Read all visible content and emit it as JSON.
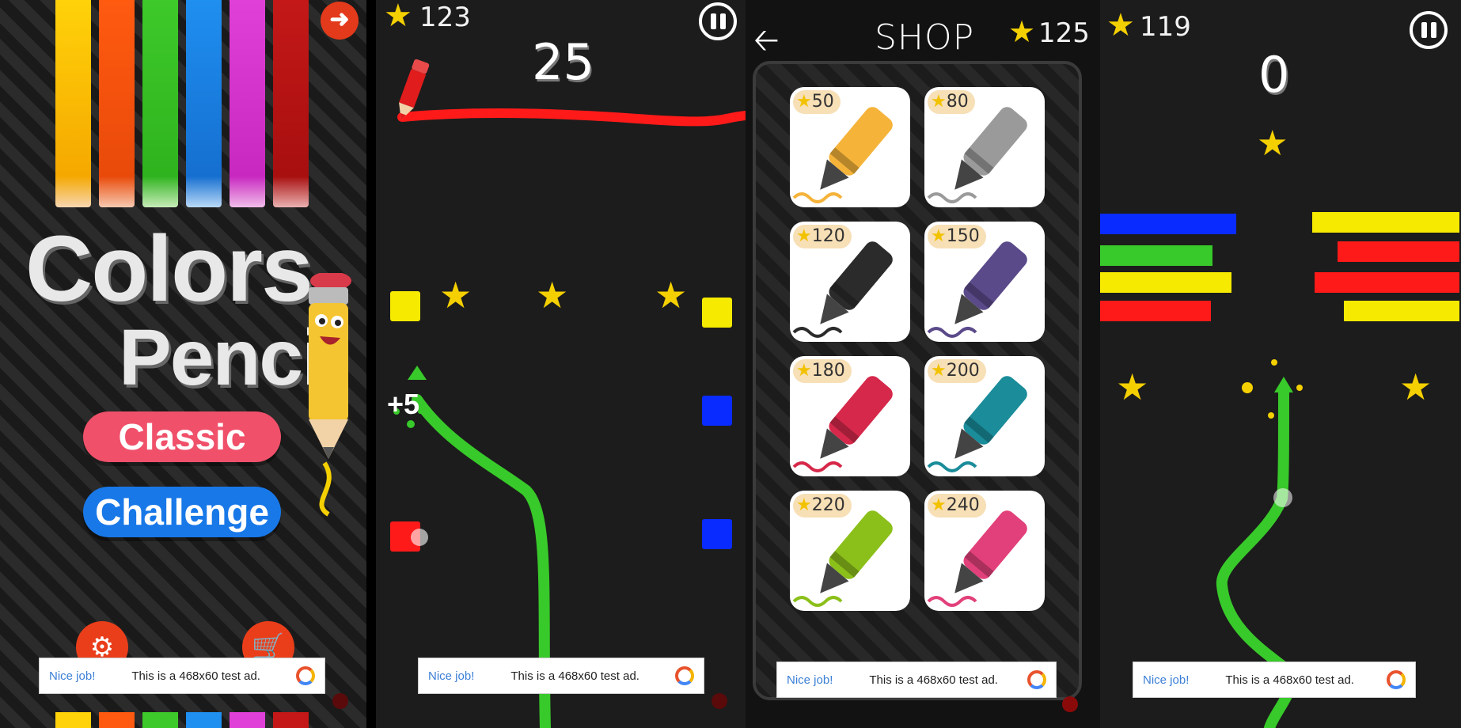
{
  "menu": {
    "title_line1": "Colors",
    "title_line2": "Pencil",
    "classic_label": "Classic",
    "challenge_label": "Challenge",
    "back_icon": "back-arrow-icon",
    "settings_icon": "gear-icon",
    "shop_icon": "cart-icon",
    "bar_colors": [
      "#ffd20a",
      "#ff5a10",
      "#3ec92a",
      "#1f8ff0",
      "#e040d8",
      "#c41818"
    ]
  },
  "game1": {
    "star_count": "123",
    "score": "25",
    "bonus": "+5"
  },
  "shop": {
    "title": "SHOP",
    "star_count": "125",
    "items": [
      {
        "price": "50",
        "item": "highlighter-orange",
        "color": "#f5b33a"
      },
      {
        "price": "80",
        "item": "crayon-gray",
        "color": "#9a9a9a"
      },
      {
        "price": "120",
        "item": "fountain-pen-black",
        "color": "#2b2b2b"
      },
      {
        "price": "150",
        "item": "fountain-pen-purple",
        "color": "#5b4a8a"
      },
      {
        "price": "180",
        "item": "marker-red",
        "color": "#d6284a"
      },
      {
        "price": "200",
        "item": "marker-teal",
        "color": "#1a8c9a"
      },
      {
        "price": "220",
        "item": "brush-green",
        "color": "#8bbf1a"
      },
      {
        "price": "240",
        "item": "brush-pink",
        "color": "#e2407a"
      }
    ]
  },
  "game2": {
    "star_count": "119",
    "score": "0"
  },
  "ad": {
    "nice_label": "Nice job!",
    "message": "This is a 468x60 test ad."
  },
  "colors": {
    "red": "#ff1a1a",
    "green": "#38c92a",
    "yellow": "#f5ea00",
    "blue": "#0a2bff",
    "classic_btn": "#f0506a",
    "challenge_btn": "#1878e8"
  }
}
